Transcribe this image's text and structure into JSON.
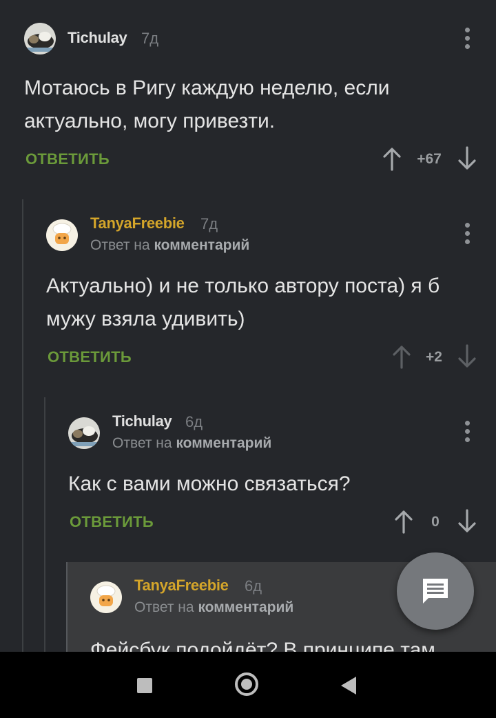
{
  "comments": [
    {
      "author": "Tichulay",
      "time": "7д",
      "reply_prefix": "",
      "reply_target": "",
      "text_lines": [
        "Мотаюсь в Ригу каждую неделю, если",
        "актуально, могу привезти."
      ],
      "reply_label": "ОТВЕТИТЬ",
      "score": "+67"
    },
    {
      "author": "TanyaFreebie",
      "time": "7д",
      "reply_prefix": "Ответ на",
      "reply_target": "комментарий",
      "text_lines": [
        "Актуально) и не только автору поста) я б",
        "мужу взяла удивить)"
      ],
      "reply_label": "ОТВЕТИТЬ",
      "score": "+2"
    },
    {
      "author": "Tichulay",
      "time": "6д",
      "reply_prefix": "Ответ на",
      "reply_target": "комментарий",
      "text_lines": [
        "Как с вами можно связаться?"
      ],
      "reply_label": "ОТВЕТИТЬ",
      "score": "0"
    },
    {
      "author": "TanyaFreebie",
      "time": "6д",
      "reply_prefix": "Ответ на",
      "reply_target": "комментарий",
      "text_lines": [
        "Фейсбук подойдёт? В принципе там"
      ]
    }
  ],
  "icons": {
    "more": "more-vertical-icon",
    "upvote": "arrow-up-icon",
    "downvote": "arrow-down-icon",
    "fab": "comment-icon",
    "nav_recent": "square-icon",
    "nav_home": "circle-icon",
    "nav_back": "triangle-back-icon"
  },
  "colors": {
    "background": "#25272b",
    "author_gold": "#d4a52a",
    "reply_green": "#6b9a3a",
    "highlight": "#3a3b3d"
  }
}
